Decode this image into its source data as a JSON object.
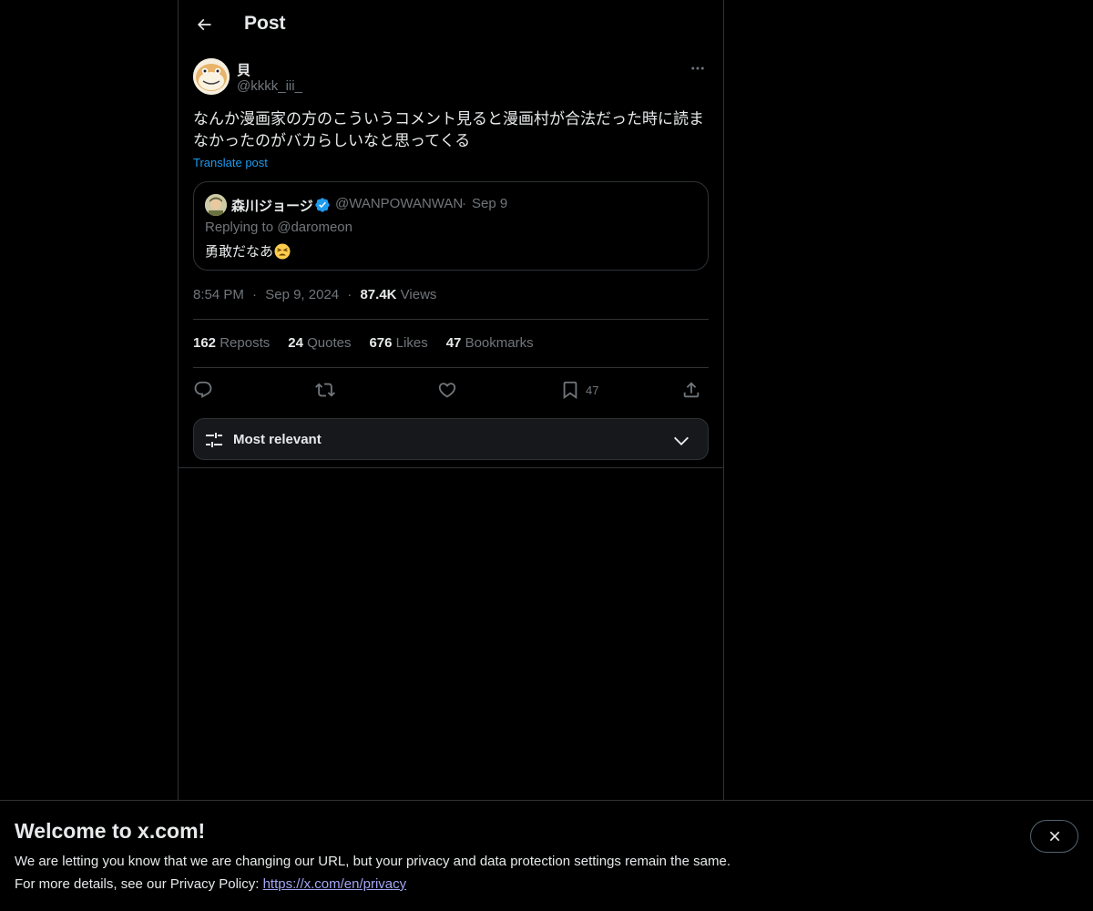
{
  "header": {
    "title": "Post",
    "back_icon": "arrow-left-icon"
  },
  "post": {
    "author_name": "貝",
    "author_handle": "@kkkk_iii_",
    "text_line1": "なんか漫画家の方のこういうコメント見ると漫画村が合法だった時に読ま",
    "text_line2": "なかったのがバカらしいなと思ってくる",
    "translate_label": "Translate post",
    "time": "8:54 PM",
    "date": "Sep 9, 2024",
    "views_count": "87.4K",
    "views_label": "Views",
    "meta_sep": "·"
  },
  "quote": {
    "author_name": "森川ジョージ",
    "author_handle": "@WANPOWANWAN",
    "sep": "·",
    "date": "Sep 9",
    "replying_to_label": "Replying to",
    "replying_to_handle": "@daromeon",
    "text": "勇敢だなあ",
    "emoji_icon": "tired-face-emoji-icon",
    "verified_color": "#1d9bf0"
  },
  "stats": {
    "reposts_count": "162",
    "reposts_label": "Reposts",
    "quotes_count": "24",
    "quotes_label": "Quotes",
    "likes_count": "676",
    "likes_label": "Likes",
    "bookmarks_count": "47",
    "bookmarks_label": "Bookmarks"
  },
  "actions": {
    "bookmark_count": "47"
  },
  "sort": {
    "label": "Most relevant"
  },
  "banner": {
    "title": "Welcome to x.com!",
    "line1": "We are letting you know that we are changing our URL, but your privacy and data protection settings remain the same.",
    "line2_prefix": "For more details, see our Privacy Policy: ",
    "link_text": "https://x.com/en/privacy"
  },
  "colors": {
    "accent": "#1d9bf0",
    "background": "#000000",
    "text": "#e7e9ea",
    "muted": "#71767b",
    "border": "#2f3336",
    "link": "#a3a6f5"
  }
}
